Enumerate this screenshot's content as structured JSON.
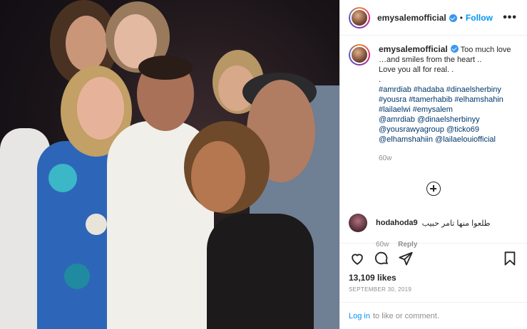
{
  "post": {
    "username": "emysalemofficial",
    "follow_label": "Follow",
    "separator": "•",
    "more_label": "•••",
    "caption": {
      "username": "emysalemofficial",
      "lines": [
        "Too much love",
        "…and smiles from the heart ..",
        "Love you all for real. .",
        "."
      ],
      "tags": [
        "#amrdiab #hadaba #dinaelsherbiny",
        "#yousra #tamerhabib #elhamshahin",
        "#lailaelwi #emysalem",
        "@amrdiab @dinaelsherbinyy",
        "@yousrawyagroup @ticko69",
        "@elhamshahiin @lailaelouiofficial"
      ],
      "time": "60w"
    },
    "comment": {
      "username": "hodahoda9",
      "text": "طلعوا منها تامر حبيب",
      "time": "60w",
      "reply_label": "Reply"
    },
    "likes": "13,109 likes",
    "date": "SEPTEMBER 30, 2019",
    "login": {
      "link": "Log in",
      "text": "to like or comment."
    },
    "icons": {
      "like": "heart-icon",
      "comment": "comment-icon",
      "share": "share-icon",
      "save": "bookmark-icon",
      "load_more": "plus-circle-icon"
    }
  }
}
